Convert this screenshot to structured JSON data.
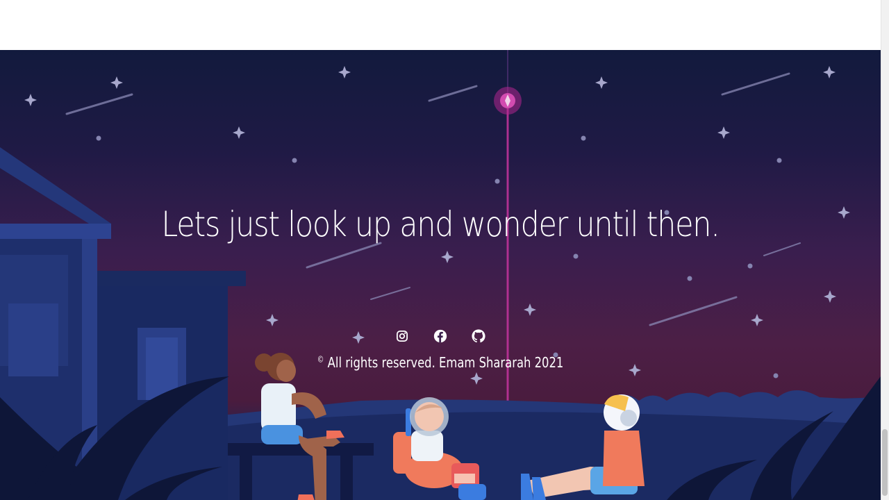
{
  "footer": {
    "tagline": "Lets just look up and wonder until then.",
    "copyright_symbol": "©",
    "copyright_text": "All rights reserved. Emam Shararah 2021",
    "socials": [
      {
        "icon": "instagram-icon"
      },
      {
        "icon": "facebook-icon"
      },
      {
        "icon": "github-icon"
      }
    ]
  },
  "colors": {
    "sky_top": "#121a3d",
    "sky_bottom": "#4a1c3e",
    "ground": "#1a2452",
    "text": "#ffffff"
  }
}
